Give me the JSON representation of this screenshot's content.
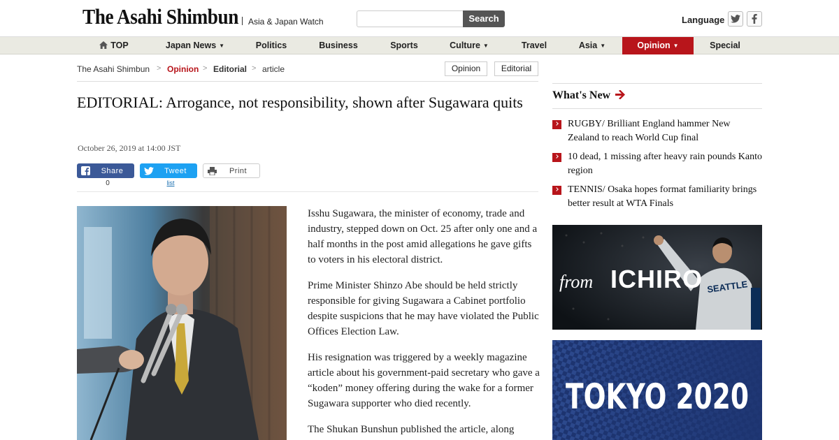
{
  "header": {
    "logo": "The Asahi Shimbun",
    "tagline": "Asia & Japan Watch",
    "search": {
      "button": "Search",
      "placeholder": ""
    },
    "language": "Language",
    "social": [
      {
        "icon": "twitter-icon"
      },
      {
        "icon": "facebook-icon"
      }
    ]
  },
  "nav": {
    "items": [
      {
        "label": "TOP",
        "icon": "home-icon"
      },
      {
        "label": "Japan News",
        "dropdown": true
      },
      {
        "label": "Politics"
      },
      {
        "label": "Business"
      },
      {
        "label": "Sports"
      },
      {
        "label": "Culture",
        "dropdown": true
      },
      {
        "label": "Travel"
      },
      {
        "label": "Asia",
        "dropdown": true
      },
      {
        "label": "Opinion",
        "dropdown": true,
        "active": true
      },
      {
        "label": "Special"
      }
    ],
    "active_color": "#b8151b"
  },
  "breadcrumb": {
    "items": [
      "The Asahi Shimbun",
      "Opinion",
      "Editorial",
      "article"
    ],
    "separator": ">"
  },
  "tags": [
    "Opinion",
    "Editorial"
  ],
  "article": {
    "title": "EDITORIAL: Arrogance, not responsibility, shown after Sugawara quits",
    "date": "October 26, 2019 at 14:00 JST",
    "share": [
      {
        "label": "Share",
        "icon": "facebook-icon",
        "count": "0",
        "color": "#3b5998"
      },
      {
        "label": "Tweet",
        "icon": "twitter-icon",
        "count": "list",
        "color": "#1da1f2"
      },
      {
        "label": "Print",
        "icon": "printer-icon",
        "count": "",
        "color": "#ffffff"
      }
    ],
    "paragraphs": [
      "Isshu Sugawara, the minister of economy, trade and industry, stepped down on Oct. 25 after only one and a half months in the post amid allegations he gave gifts to voters in his electoral district.",
      "Prime Minister Shinzo Abe should be held strictly responsible for giving Sugawara a Cabinet portfolio despite suspicions that he may have violated the Public Offices Election Law.",
      "His resignation was triggered by a weekly magazine article about his government-paid secretary who gave a “koden” money offering during the wake for a former Sugawara supporter who died recently.",
      "The Shukan Bunshun published the article, along"
    ]
  },
  "sidebar": {
    "whats_new": "What's New",
    "items": [
      "RUGBY/ Brilliant England hammer New Zealand to reach World Cup final",
      "10 dead, 1 missing after heavy rain pounds Kanto region",
      "TENNIS/ Osaka hopes format familiarity brings better result at WTA Finals"
    ],
    "banner1": {
      "script": "from",
      "word": "ICHIRO",
      "jersey": "SEATTLE"
    },
    "banner2": {
      "text": "TOKYO 2020"
    }
  }
}
